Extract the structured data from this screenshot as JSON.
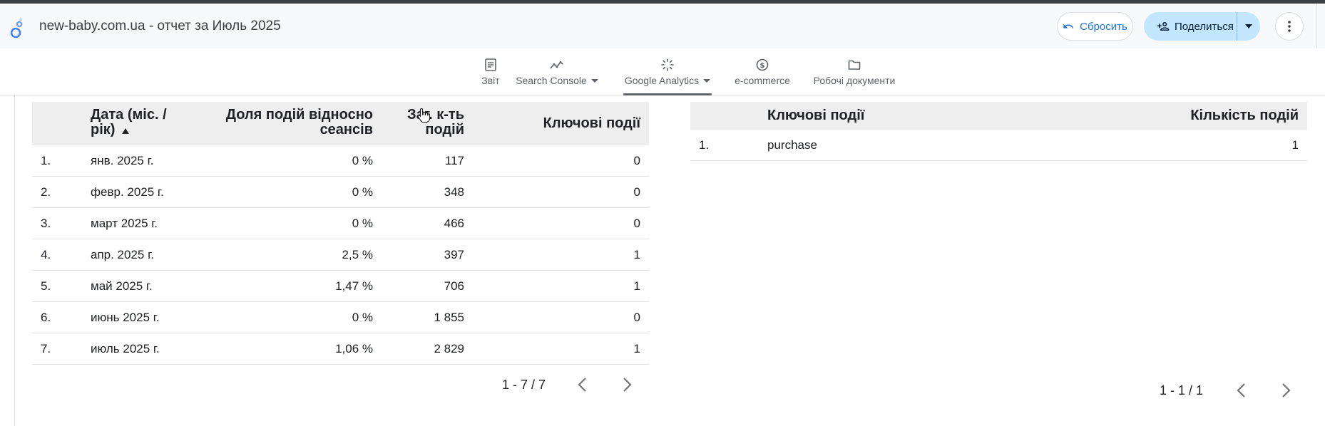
{
  "header": {
    "report_title": "new-baby.com.ua - отчет за Июль 2025",
    "reset_label": "Сбросить",
    "share_label": "Поделиться"
  },
  "nav": {
    "tabs": [
      {
        "label": "Звіт",
        "icon": "report-icon"
      },
      {
        "label": "Search Console",
        "icon": "trend-icon",
        "has_dropdown": true
      },
      {
        "label": "Google Analytics",
        "icon": "sparkle-icon",
        "has_dropdown": true,
        "active": true
      },
      {
        "label": "e-commerce",
        "icon": "dollar-icon"
      },
      {
        "label": "Робочі документи",
        "icon": "folder-icon"
      }
    ]
  },
  "table1": {
    "headers": {
      "date": "Дата (міс. / рік)",
      "share": "Доля подій відносно сеансів",
      "count": "Заг. к-ть подій",
      "key_events": "Ключові події"
    },
    "rows": [
      {
        "n": "1.",
        "date": "янв. 2025 г.",
        "share": "0 %",
        "count": "117",
        "key": "0"
      },
      {
        "n": "2.",
        "date": "февр. 2025 г.",
        "share": "0 %",
        "count": "348",
        "key": "0"
      },
      {
        "n": "3.",
        "date": "март 2025 г.",
        "share": "0 %",
        "count": "466",
        "key": "0"
      },
      {
        "n": "4.",
        "date": "апр. 2025 г.",
        "share": "2,5 %",
        "count": "397",
        "key": "1"
      },
      {
        "n": "5.",
        "date": "май 2025 г.",
        "share": "1,47 %",
        "count": "706",
        "key": "1"
      },
      {
        "n": "6.",
        "date": "июнь 2025 г.",
        "share": "0 %",
        "count": "1 855",
        "key": "0"
      },
      {
        "n": "7.",
        "date": "июль 2025 г.",
        "share": "1,06 %",
        "count": "2 829",
        "key": "1"
      }
    ],
    "pagination": "1 - 7 / 7"
  },
  "table2": {
    "headers": {
      "key_events": "Ключові події",
      "event_count": "Кількість подій"
    },
    "rows": [
      {
        "n": "1.",
        "event": "purchase",
        "count": "1"
      }
    ],
    "pagination": "1 - 1 / 1"
  },
  "colors": {
    "accent": "#1a73e8",
    "share_bg": "#c2e7ff",
    "table_header_bg": "#eeeeee"
  }
}
